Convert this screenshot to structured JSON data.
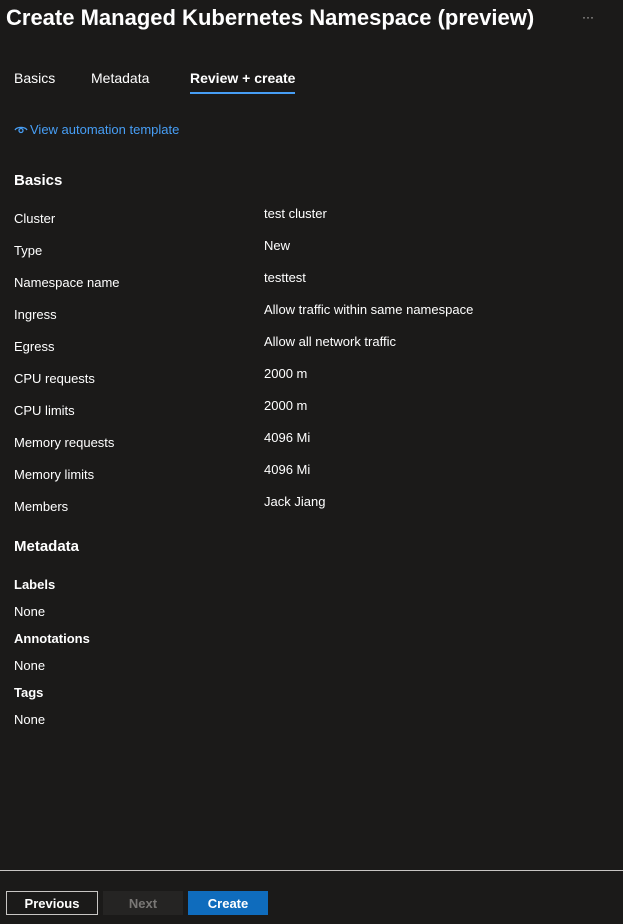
{
  "header": {
    "title": "Create Managed Kubernetes Namespace (preview)",
    "more_icon": "ellipsis-icon",
    "more_label": "···"
  },
  "tabs": [
    {
      "label": "Basics",
      "active": false
    },
    {
      "label": "Metadata",
      "active": false
    },
    {
      "label": "Review + create",
      "active": true
    }
  ],
  "automation": {
    "icon": "eye-icon",
    "label": "View automation template"
  },
  "basics": {
    "heading": "Basics",
    "rows": [
      {
        "label": "Cluster",
        "value": "test cluster"
      },
      {
        "label": "Type",
        "value": "New"
      },
      {
        "label": "Namespace name",
        "value": "testtest"
      },
      {
        "label": "Ingress",
        "value": "Allow traffic within same namespace"
      },
      {
        "label": "Egress",
        "value": "Allow all network traffic"
      },
      {
        "label": "CPU requests",
        "value": "2000 m"
      },
      {
        "label": "CPU limits",
        "value": "2000 m"
      },
      {
        "label": "Memory requests",
        "value": "4096 Mi"
      },
      {
        "label": "Memory limits",
        "value": "4096 Mi"
      },
      {
        "label": "Members",
        "value": "Jack Jiang"
      }
    ]
  },
  "metadata": {
    "heading": "Metadata",
    "groups": [
      {
        "label": "Labels",
        "value": "None"
      },
      {
        "label": "Annotations",
        "value": "None"
      },
      {
        "label": "Tags",
        "value": "None"
      }
    ]
  },
  "footer": {
    "previous_label": "Previous",
    "next_label": "Next",
    "create_label": "Create"
  },
  "colors": {
    "background": "#1b1a19",
    "accent": "#479ef5",
    "primary_button": "#0f6cbd",
    "disabled_text": "#797775"
  }
}
